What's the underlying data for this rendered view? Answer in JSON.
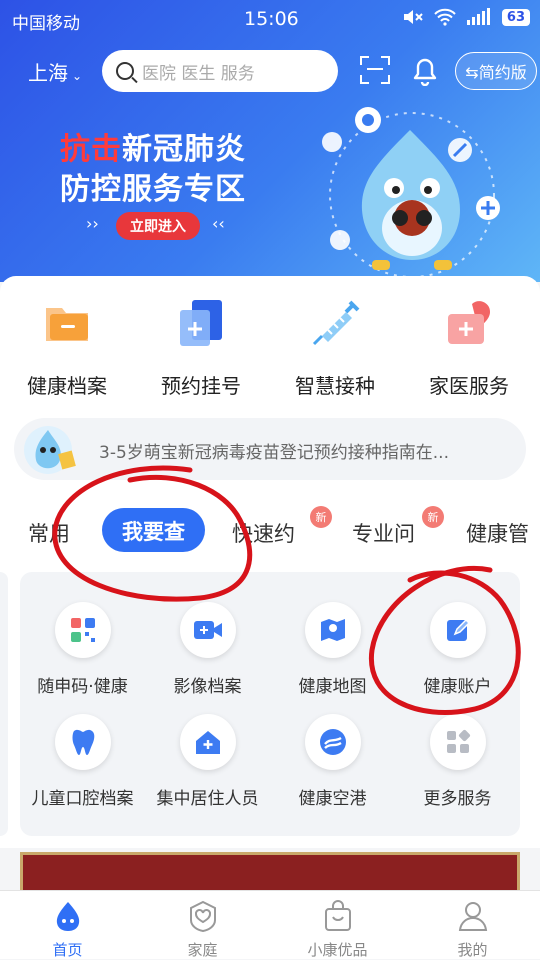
{
  "status": {
    "carrier": "中国移动",
    "time": "15:06",
    "battery": "63"
  },
  "header": {
    "city": "上海",
    "search_placeholder": "医院 医生 服务",
    "simple_mode": "⇆简约版"
  },
  "banner": {
    "title_red": "抗击",
    "title_white": "新冠肺炎",
    "subtitle": "防控服务专区",
    "enter": "立即进入"
  },
  "quick": [
    {
      "label": "健康档案",
      "icon": "folder-icon",
      "color": "#f7a13a"
    },
    {
      "label": "预约挂号",
      "icon": "register-icon",
      "color": "#3d7bf2"
    },
    {
      "label": "智慧接种",
      "icon": "syringe-icon",
      "color": "#4aa6ef"
    },
    {
      "label": "家医服务",
      "icon": "medical-kit-icon",
      "color": "#f26565"
    }
  ],
  "notice": {
    "text": "3-5岁萌宝新冠病毒疫苗登记预约接种指南在..."
  },
  "tabs": [
    {
      "label": "常用"
    },
    {
      "label": "我要查",
      "active": true
    },
    {
      "label": "快速约"
    },
    {
      "label": "专业问",
      "badge": "新"
    },
    {
      "label": "健康管",
      "badge": "新"
    }
  ],
  "services": [
    {
      "label": "随申码·健康",
      "icon": "qr-code-icon"
    },
    {
      "label": "影像档案",
      "icon": "video-icon"
    },
    {
      "label": "健康地图",
      "icon": "map-icon"
    },
    {
      "label": "健康账户",
      "icon": "edit-icon"
    },
    {
      "label": "儿童口腔档案",
      "icon": "tooth-icon"
    },
    {
      "label": "集中居住人员",
      "icon": "home-plus-icon"
    },
    {
      "label": "健康空港",
      "icon": "airport-icon"
    },
    {
      "label": "更多服务",
      "icon": "grid-icon"
    }
  ],
  "tabbar": [
    {
      "label": "首页",
      "active": true
    },
    {
      "label": "家庭"
    },
    {
      "label": "小康优品"
    },
    {
      "label": "我的"
    }
  ],
  "colors": {
    "primary": "#2f6ff5",
    "annotation": "#d7131a"
  }
}
